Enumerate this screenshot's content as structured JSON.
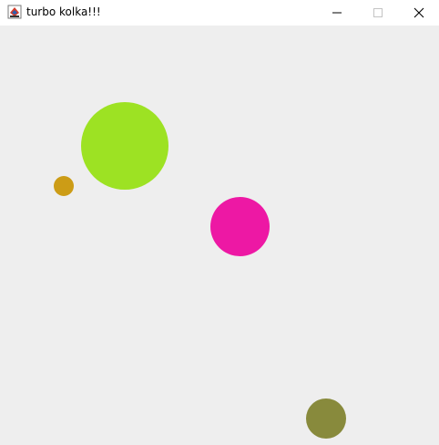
{
  "window": {
    "title": "turbo kolka!!!"
  },
  "icons": {
    "app": "java-coffee-cup-icon",
    "minimize": "minimize-icon",
    "maximize": "maximize-icon",
    "close": "close-icon"
  },
  "canvas": {
    "background": "#eeeeee"
  },
  "balls": [
    {
      "name": "green-ball",
      "color": "#9de223"
    },
    {
      "name": "orange-ball",
      "color": "#cc9c16"
    },
    {
      "name": "pink-ball",
      "color": "#ed18a4"
    },
    {
      "name": "olive-ball",
      "color": "#888a3c"
    }
  ]
}
